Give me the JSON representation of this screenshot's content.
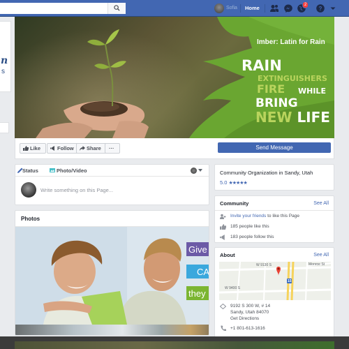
{
  "topbar": {
    "search_placeholder": "",
    "user_name": "Sofia",
    "home_label": "Home",
    "notification_count": "2"
  },
  "cover": {
    "tagline": "Imber: Latin for Rain",
    "line_rain": "RAIN",
    "line_extinguishers": "EXTINGUISHERS",
    "line_fire": "FIRE",
    "line_while": "WHILE",
    "line_bring": "BRING",
    "line_new": "NEW",
    "line_life": "LIFE"
  },
  "actions": {
    "like": "Like",
    "follow": "Follow",
    "share": "Share",
    "more": "···",
    "send_message": "Send Message"
  },
  "composer": {
    "status": "Status",
    "photo_video": "Photo/Video",
    "placeholder": "Write something on this Page..."
  },
  "photos": {
    "title": "Photos",
    "tab_words": [
      "Give",
      "CA",
      "they"
    ]
  },
  "page_info": {
    "category": "Community Organization in Sandy, Utah",
    "rating": "5.0",
    "stars": "★★★★★"
  },
  "community": {
    "title": "Community",
    "see_all": "See All",
    "invite_link": "Invite your friends",
    "invite_rest": " to like this Page",
    "likes": "185 people like this",
    "follows": "183 people follow this"
  },
  "about": {
    "title": "About",
    "see_all": "See All",
    "map_labels": {
      "street1": "W 9130 S",
      "street2": "Monroe St",
      "street3": "W 9400 S",
      "highway": "15"
    },
    "address_line1": "9192 S 300 W, # 14",
    "address_line2": "Sandy, Utah 84070",
    "directions": "Get Directions",
    "phone": "+1 801-613-1616"
  },
  "colors": {
    "facebook_blue": "#4267b2",
    "cover_green": "#6aa631",
    "accent_lime": "#b9d45d"
  }
}
